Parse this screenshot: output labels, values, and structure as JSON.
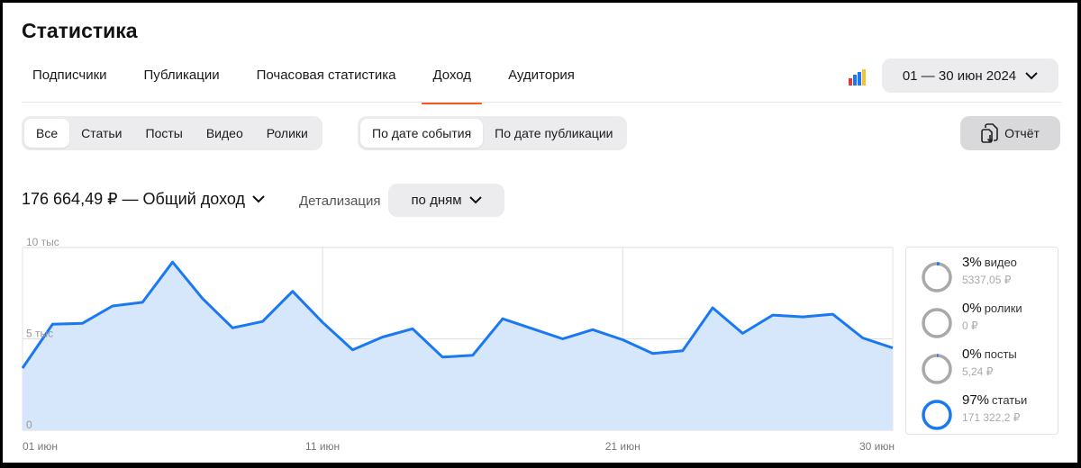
{
  "page": {
    "title": "Статистика"
  },
  "tabs": [
    {
      "label": "Подписчики",
      "active": false
    },
    {
      "label": "Публикации",
      "active": false
    },
    {
      "label": "Почасовая статистика",
      "active": false
    },
    {
      "label": "Доход",
      "active": true
    },
    {
      "label": "Аудитория",
      "active": false
    }
  ],
  "date_range": "01 — 30 июн 2024",
  "content_filter": {
    "items": [
      "Все",
      "Статьи",
      "Посты",
      "Видео",
      "Ролики"
    ],
    "active": 0
  },
  "date_filter": {
    "items": [
      "По дате события",
      "По дате публикации"
    ],
    "active": 0
  },
  "report_button": "Отчёт",
  "total": "176 664,49 ₽ — Общий доход",
  "detail": {
    "label": "Детализация",
    "value": "по дням"
  },
  "colors": {
    "accent": "#f25a22",
    "line": "#1a78f2",
    "fill": "#d6e7fb",
    "ring_gray": "#a9a9a9",
    "ring_blue": "#1a78f2"
  },
  "chart_data": {
    "type": "area",
    "x": [
      "01 июн",
      "02 июн",
      "03 июн",
      "04 июн",
      "05 июн",
      "06 июн",
      "07 июн",
      "08 июн",
      "09 июн",
      "10 июн",
      "11 июн",
      "12 июн",
      "13 июн",
      "14 июн",
      "15 июн",
      "16 июн",
      "17 июн",
      "18 июн",
      "19 июн",
      "20 июн",
      "21 июн",
      "22 июн",
      "23 июн",
      "24 июн",
      "25 июн",
      "26 июн",
      "27 июн",
      "28 июн",
      "29 июн",
      "30 июн"
    ],
    "series": [
      {
        "values": [
          3400,
          5800,
          5850,
          6800,
          7000,
          9200,
          7200,
          5600,
          5950,
          7600,
          5900,
          4400,
          5100,
          5550,
          4000,
          4100,
          6100,
          5550,
          5000,
          5500,
          4950,
          4200,
          4350,
          6700,
          5300,
          6300,
          6200,
          6350,
          5050,
          4500
        ]
      }
    ],
    "ylim": [
      0,
      10000
    ],
    "y_ticks": [
      "10 тыс",
      "5 тыс",
      "0"
    ],
    "x_ticks": [
      "01 июн",
      "11 июн",
      "21 июн",
      "30 июн"
    ],
    "grid": true
  },
  "breakdown": [
    {
      "pct": "3%",
      "label": "видео",
      "amount": "5337,05 ₽",
      "share": 0.03,
      "color": "gray"
    },
    {
      "pct": "0%",
      "label": "ролики",
      "amount": "0 ₽",
      "share": 0,
      "color": "gray"
    },
    {
      "pct": "0%",
      "label": "посты",
      "amount": "5,24 ₽",
      "share": 0.001,
      "color": "gray"
    },
    {
      "pct": "97%",
      "label": "статьи",
      "amount": "171 322,2 ₽",
      "share": 0.97,
      "color": "blue"
    }
  ]
}
